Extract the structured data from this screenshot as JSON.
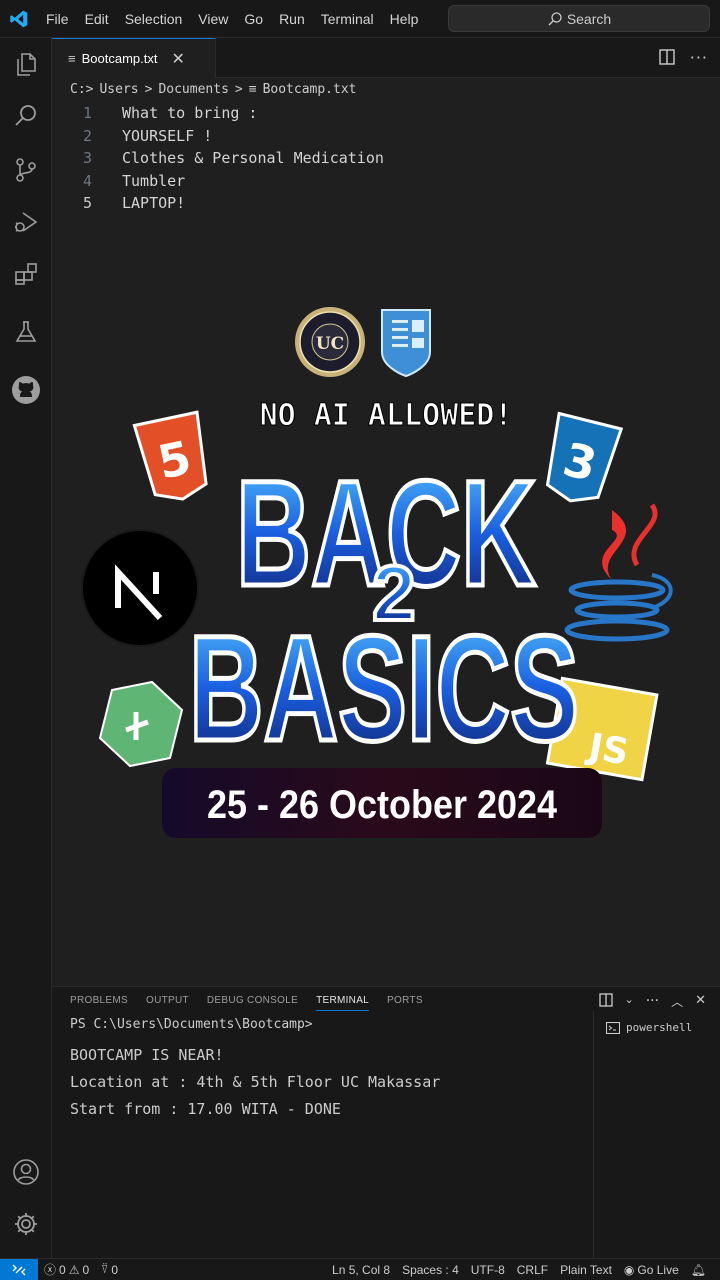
{
  "menu": [
    "File",
    "Edit",
    "Selection",
    "View",
    "Go",
    "Run",
    "Terminal",
    "Help"
  ],
  "search": {
    "label": "Search"
  },
  "tab": {
    "label": "Bootcamp.txt"
  },
  "breadcrumb": {
    "drive": "C:>",
    "folder1": "Users",
    "folder2": "Documents",
    "file": "Bootcamp.txt",
    "sep": ">"
  },
  "editor": {
    "lines": [
      {
        "num": "1",
        "text": "What to bring :"
      },
      {
        "num": "2",
        "text": "YOURSELF !"
      },
      {
        "num": "3",
        "text": "Clothes & Personal Medication"
      },
      {
        "num": "4",
        "text": "Tumbler"
      },
      {
        "num": "5",
        "text": "LAPTOP!"
      }
    ]
  },
  "poster": {
    "headline": "NO AI ALLOWED!",
    "word1": "BACK",
    "number": "2",
    "word2": "BASICS",
    "date": "25 - 26 October 2024",
    "seal_text": "UC",
    "js_badge": "JS",
    "html_badge": "5",
    "css_badge": "3"
  },
  "panel": {
    "tabs": [
      "PROBLEMS",
      "OUTPUT",
      "DEBUG CONSOLE",
      "TERMINAL",
      "PORTS"
    ],
    "prompt": "PS C:\\Users\\Documents\\Bootcamp>",
    "output": [
      "BOOTCAMP IS NEAR!",
      "Location at : 4th & 5th Floor UC Makassar",
      "Start from : 17.00 WITA - DONE"
    ],
    "shell": "powershell"
  },
  "status": {
    "errors": "0",
    "warnings": "0",
    "ports": "0",
    "position": "Ln 5, Col 8",
    "spaces": "Spaces : 4",
    "encoding": "UTF-8",
    "eol": "CRLF",
    "language": "Plain Text",
    "golive": "Go Live"
  },
  "colors": {
    "accent": "#0078d4",
    "editor_bg": "#1f1f1f",
    "chrome_bg": "#181818"
  }
}
